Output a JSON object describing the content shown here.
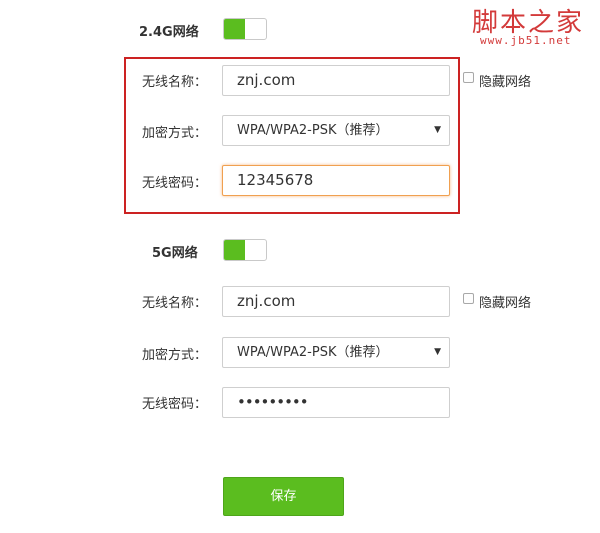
{
  "watermark": {
    "title": "脚本之家",
    "url": "www.jb51.net"
  },
  "wifi_24g": {
    "section_label": "2.4G网络",
    "toggle_on": true,
    "ssid_label": "无线名称：",
    "ssid_value": "znj.com",
    "hide_label": "隐藏网络",
    "hide_checked": false,
    "security_label": "加密方式：",
    "security_value": "WPA/WPA2-PSK（推荐）",
    "password_label": "无线密码：",
    "password_value": "12345678"
  },
  "wifi_5g": {
    "section_label": "5G网络",
    "toggle_on": true,
    "ssid_label": "无线名称：",
    "ssid_value": "znj.com",
    "hide_label": "隐藏网络",
    "hide_checked": false,
    "security_label": "加密方式：",
    "security_value": "WPA/WPA2-PSK（推荐）",
    "password_label": "无线密码：",
    "password_masked": "•••••••••"
  },
  "save_label": "保存",
  "colors": {
    "accent_green": "#5bbd1f",
    "highlight_red": "#cc2222",
    "focus_orange": "#f0a050"
  }
}
